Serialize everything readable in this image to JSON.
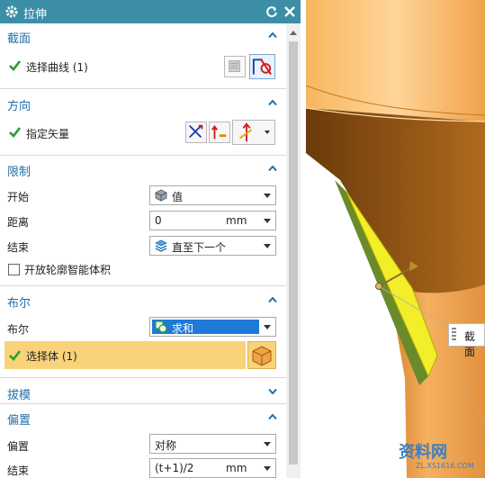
{
  "dialog": {
    "title": "拉伸",
    "sections": {
      "section": {
        "title": "截面",
        "select_curve_label": "选择曲线 (1)"
      },
      "direction": {
        "title": "方向",
        "specify_vector_label": "指定矢量"
      },
      "limits": {
        "title": "限制",
        "start_label": "开始",
        "start_value": "值",
        "distance_label": "距离",
        "distance_value": "0",
        "distance_unit": "mm",
        "end_label": "结束",
        "end_value": "直至下一个",
        "open_profile_label": "开放轮廓智能体积"
      },
      "boolean": {
        "title": "布尔",
        "boolean_label": "布尔",
        "boolean_value": "求和",
        "select_body_label": "选择体 (1)"
      },
      "draft": {
        "title": "拔模"
      },
      "offset": {
        "title": "偏置",
        "offset_label": "偏置",
        "offset_value": "对称",
        "end_label": "结束",
        "end_value": "(t+1)/2",
        "end_unit": "mm"
      }
    }
  },
  "viewport": {
    "tooltip": "截面",
    "watermark_text": "资料网",
    "watermark_url": "ZL.XS1616.COM"
  },
  "colors": {
    "title_bar": "#3b8ea5",
    "section_title": "#1f6fa8",
    "check_green": "#2e9a2e",
    "highlight_row": "#f9d37a",
    "selected_item": "#1e7ad6",
    "model_orange": "#f0a24a"
  }
}
